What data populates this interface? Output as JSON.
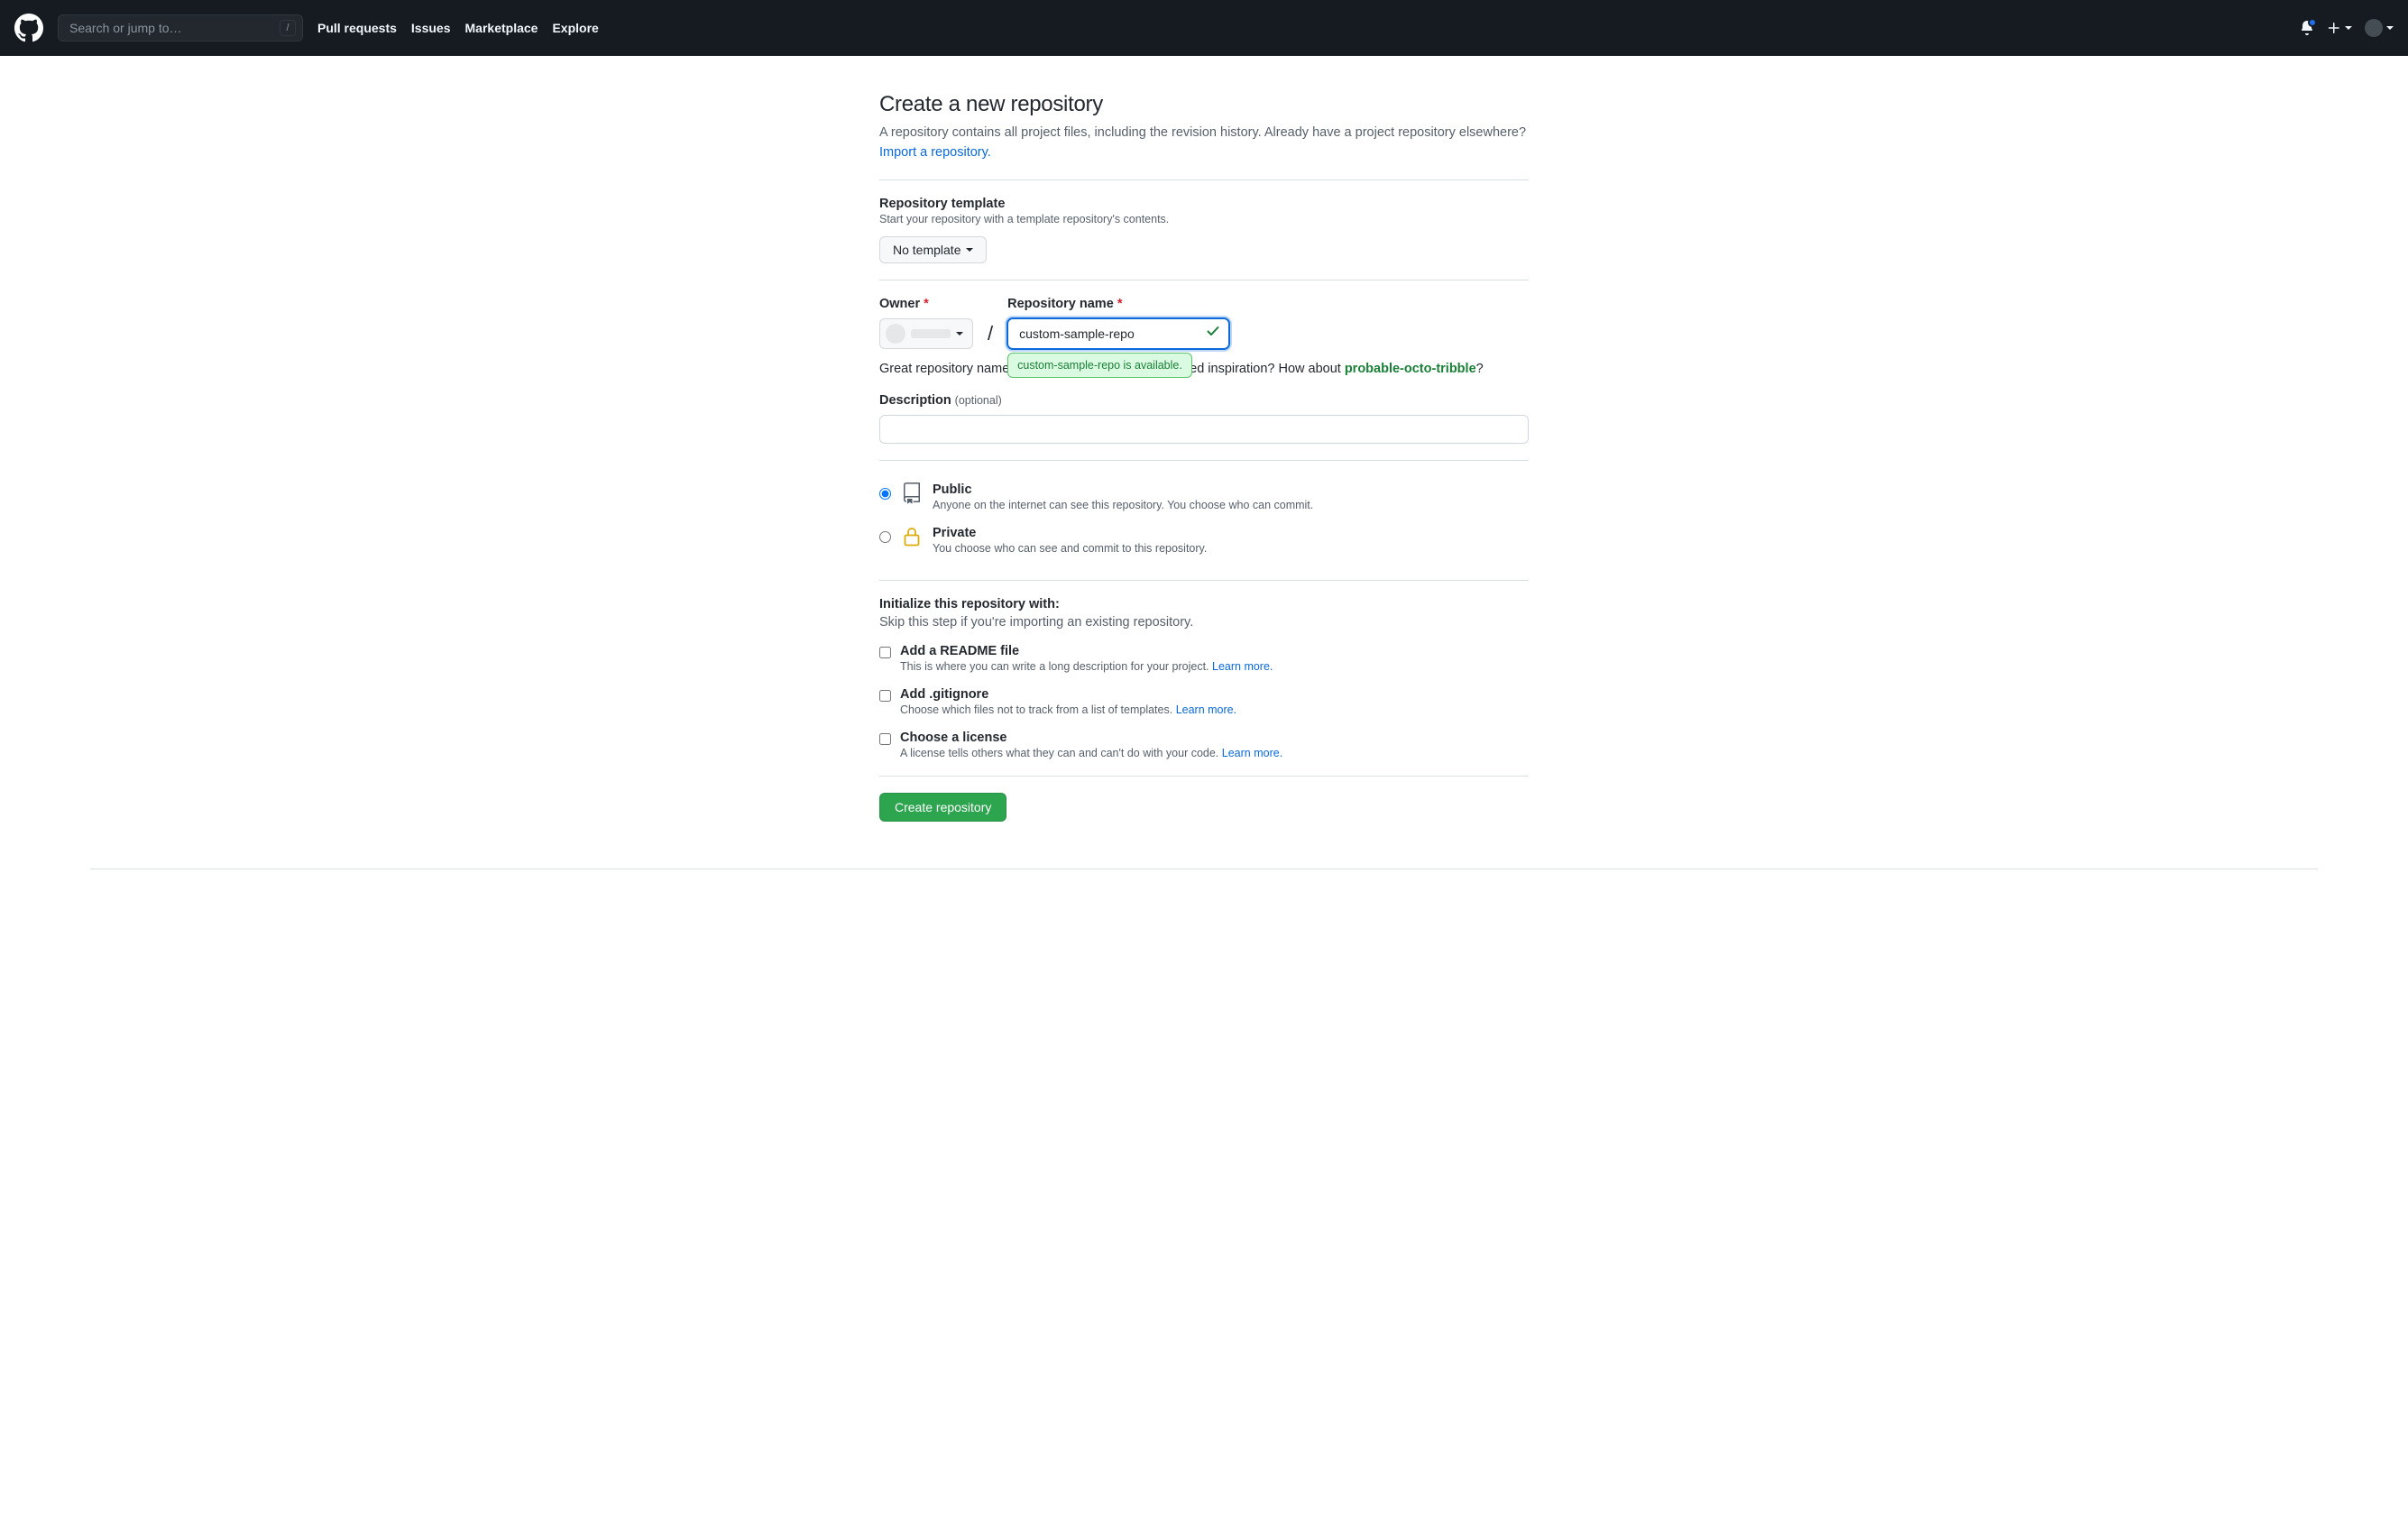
{
  "header": {
    "search_placeholder": "Search or jump to…",
    "slash_key": "/",
    "nav": [
      "Pull requests",
      "Issues",
      "Marketplace",
      "Explore"
    ]
  },
  "page": {
    "title": "Create a new repository",
    "desc_prefix": "A repository contains all project files, including the revision history. Already have a project repository elsewhere? ",
    "import_link": "Import a repository."
  },
  "template": {
    "title": "Repository template",
    "sub": "Start your repository with a template repository's contents.",
    "button": "No template"
  },
  "owner": {
    "label": "Owner",
    "separator": "/"
  },
  "repo": {
    "label": "Repository name",
    "value": "custom-sample-repo",
    "availability": "custom-sample-repo is available."
  },
  "hint": {
    "prefix": "Great repository names are short and memorable. Need inspiration? How about ",
    "suggestion": "probable-octo-tribble",
    "suffix": "?"
  },
  "description": {
    "label": "Description",
    "optional": "(optional)"
  },
  "visibility": {
    "public": {
      "title": "Public",
      "sub": "Anyone on the internet can see this repository. You choose who can commit."
    },
    "private": {
      "title": "Private",
      "sub": "You choose who can see and commit to this repository."
    }
  },
  "init": {
    "title": "Initialize this repository with:",
    "sub": "Skip this step if you're importing an existing repository.",
    "readme": {
      "title": "Add a README file",
      "sub_prefix": "This is where you can write a long description for your project. ",
      "learn": "Learn more."
    },
    "gitignore": {
      "title": "Add .gitignore",
      "sub_prefix": "Choose which files not to track from a list of templates. ",
      "learn": "Learn more."
    },
    "license": {
      "title": "Choose a license",
      "sub_prefix": "A license tells others what they can and can't do with your code. ",
      "learn": "Learn more."
    }
  },
  "submit": {
    "label": "Create repository"
  }
}
